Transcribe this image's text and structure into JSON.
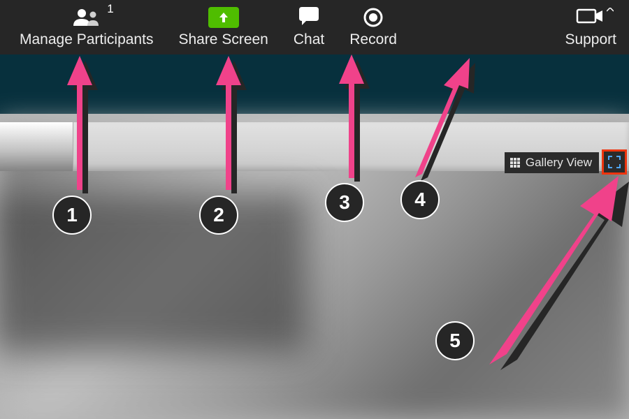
{
  "toolbar": {
    "manage_participants": {
      "label": "Manage Participants",
      "badge": "1"
    },
    "share_screen": {
      "label": "Share Screen"
    },
    "chat": {
      "label": "Chat"
    },
    "record": {
      "label": "Record"
    },
    "support": {
      "label": "Support"
    }
  },
  "gallery_view": {
    "label": "Gallery View"
  },
  "annotations": {
    "numbers": [
      "1",
      "2",
      "3",
      "4",
      "5"
    ],
    "arrow_color": "#f0428a"
  },
  "colors": {
    "toolbar_bg": "#262626",
    "share_green": "#4fbd00",
    "second_bar": "#07303d",
    "highlight": "#ee340e"
  }
}
